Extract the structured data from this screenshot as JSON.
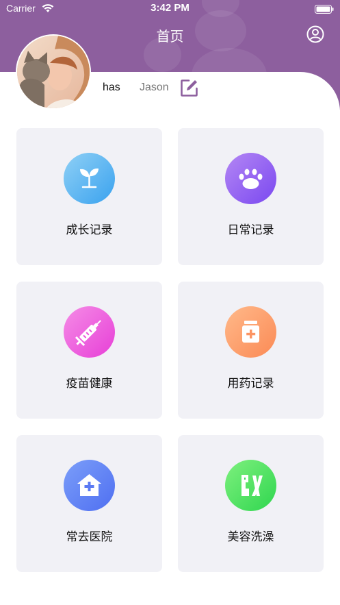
{
  "status_bar": {
    "carrier": "Carrier",
    "time": "3:42 PM"
  },
  "header": {
    "title": "首页",
    "profile_icon": "person-circle-icon"
  },
  "user": {
    "name": "has",
    "nickname": "Jason",
    "edit_icon": "edit-icon"
  },
  "colors": {
    "header_purple": "#8d5f9e",
    "card_bg": "#f1f1f6"
  },
  "cards": [
    {
      "label": "成长记录",
      "icon": "sprout-icon",
      "gradient": [
        "#8fd0f5",
        "#3aa2ef"
      ]
    },
    {
      "label": "日常记录",
      "icon": "paw-icon",
      "gradient": [
        "#b487f4",
        "#7a48f0"
      ]
    },
    {
      "label": "疫苗健康",
      "icon": "syringe-icon",
      "gradient": [
        "#f58ce6",
        "#e73fd7"
      ]
    },
    {
      "label": "用药记录",
      "icon": "medicine-bottle-icon",
      "gradient": [
        "#ffb98a",
        "#fb8a55"
      ]
    },
    {
      "label": "常去医院",
      "icon": "hospital-icon",
      "gradient": [
        "#7b9ef9",
        "#4f6ff1"
      ]
    },
    {
      "label": "美容洗澡",
      "icon": "grooming-icon",
      "gradient": [
        "#7ef07e",
        "#2fd64f"
      ]
    }
  ]
}
